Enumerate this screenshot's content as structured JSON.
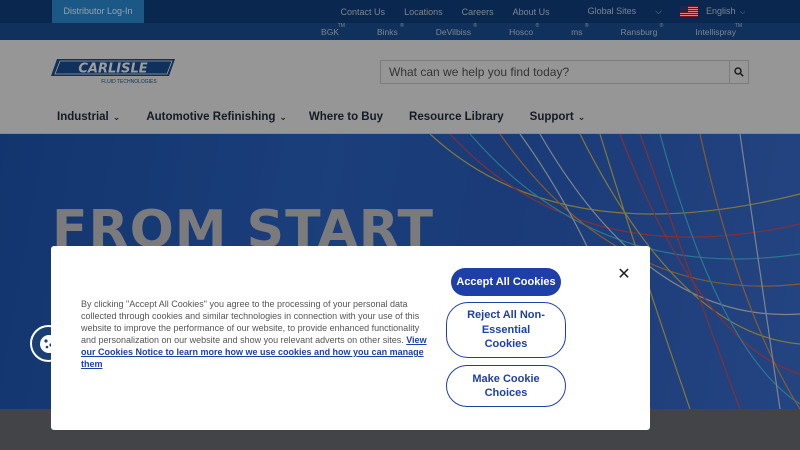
{
  "topbar": {
    "distributor_label": "Distributor Log-In",
    "links": [
      "Contact Us",
      "Locations",
      "Careers",
      "About Us"
    ],
    "global_sites": "Global Sites",
    "language": "English"
  },
  "brandbar": {
    "brands": [
      {
        "name": "BGK",
        "mark": "TM"
      },
      {
        "name": "Binks",
        "mark": "®"
      },
      {
        "name": "DeVilbiss",
        "mark": "®"
      },
      {
        "name": "Hosco",
        "mark": "®"
      },
      {
        "name": "ms",
        "mark": "®"
      },
      {
        "name": "Ransburg",
        "mark": "®"
      },
      {
        "name": "Intellispray",
        "mark": "TM"
      }
    ]
  },
  "header": {
    "logo_main": "CARLISLE",
    "logo_sub": "FLUID TECHNOLOGIES",
    "search_placeholder": "What can we help you find today?",
    "nav": [
      {
        "label": "Industrial",
        "has_menu": true
      },
      {
        "label": "Automotive Refinishing",
        "has_menu": true
      },
      {
        "label": "Where to Buy",
        "has_menu": false
      },
      {
        "label": "Resource Library",
        "has_menu": false
      },
      {
        "label": "Support",
        "has_menu": true
      }
    ]
  },
  "hero": {
    "headline": "FROM START"
  },
  "cookie_modal": {
    "body_text": "By clicking \"Accept All Cookies\" you agree to the processing of your personal data collected through cookies and similar technologies in connection with your use of this website to improve the performance of our website, to provide enhanced functionality and personalization on our website and show you relevant adverts on other sites.",
    "link_text": "View our Cookies Notice to learn more how we use cookies and how you can manage them",
    "accept_label": "Accept All Cookies",
    "reject_label": "Reject All Non-Essential Cookies",
    "choices_label": "Make Cookie Choices",
    "close_icon": "close-icon"
  },
  "colors": {
    "topbar": "#0f3f80",
    "brandbar": "#1a4f93",
    "distributor_button": "#2e8fd8",
    "accent": "#1f3fa8",
    "hero": "#2c66c7"
  }
}
